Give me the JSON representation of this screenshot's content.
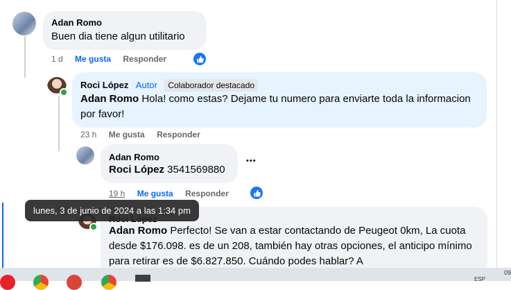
{
  "comments": [
    {
      "author": "Adan Romo",
      "text": "Buen dia tiene algun utilitario",
      "time": "1 d",
      "like": "Me gusta",
      "reply": "Responder"
    },
    {
      "author": "Roci López",
      "role": "Autor",
      "badge": "Colaborador destacado",
      "mention": "Adan Romo",
      "text": " Hola! como estas? Dejame tu numero para enviarte toda la informacion por favor!",
      "time": "23 h",
      "like": "Me gusta",
      "reply": "Responder"
    },
    {
      "author": "Adan Romo",
      "mention": "Roci López",
      "text": " 3541569880",
      "time": "19 h",
      "like": "Me gusta",
      "reply": "Responder"
    },
    {
      "author": "Roci López",
      "mention": "Adan Romo",
      "text": " Perfecto! Se van a estar contactando de Peugeot 0km, La cuota desde $176.098. es de un 208, también hay otras opciones, el anticipo mínimo para retirar es de $6.827.850. Cuándo podes hablar? A"
    }
  ],
  "tooltip": "lunes, 3 de junio de 2024 a las 1:34 pm",
  "more_options": "•••",
  "colors": {
    "link_blue": "#0866ff",
    "like_blue": "#1877f2",
    "bubble": "#f0f2f5",
    "author_bubble": "#e7f3ff",
    "online": "#31a24c"
  },
  "icons": [
    "like-thumb-icon",
    "more-options-icon",
    "online-status-icon"
  ],
  "taskbar_icons": [
    "opera-icon",
    "chrome-icon",
    "chrome-profile-icon",
    "chrome-icon",
    "app-icon"
  ],
  "taskbar_text": {
    "lang": "ESP",
    "time": "09"
  }
}
